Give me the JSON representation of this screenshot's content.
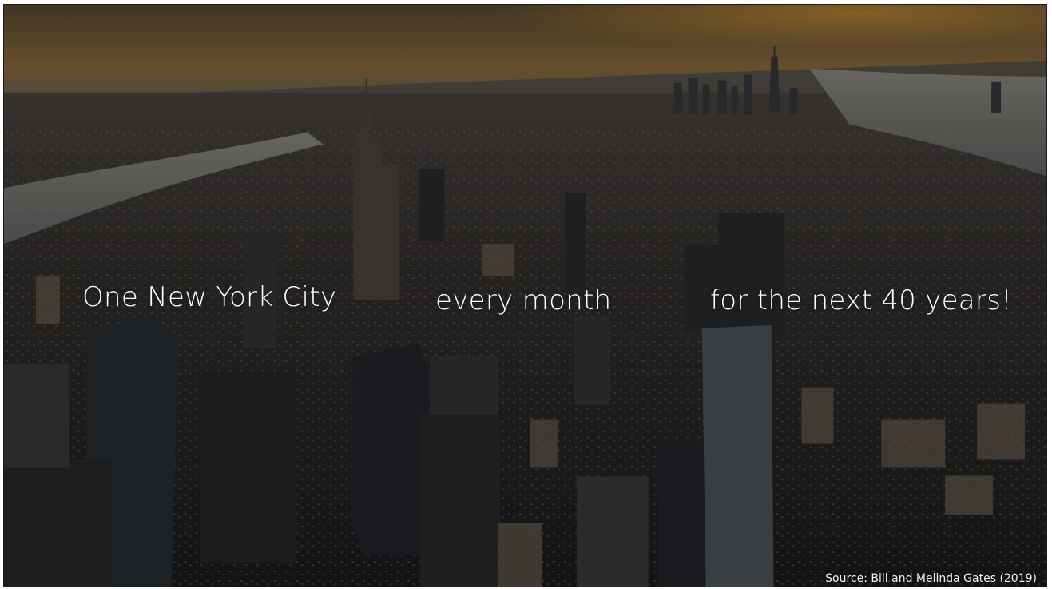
{
  "slide": {
    "captions": {
      "first": "One New York City",
      "second": "every month",
      "third": "for the next 40 years!"
    },
    "source": "Source: Bill and Melinda Gates (2019)"
  },
  "colors": {
    "sky_top": "#6b5a3b",
    "sky_glow": "#b8893e",
    "water": "#8a8f94",
    "city_dark": "#1e2024",
    "text": "#ffffff"
  }
}
